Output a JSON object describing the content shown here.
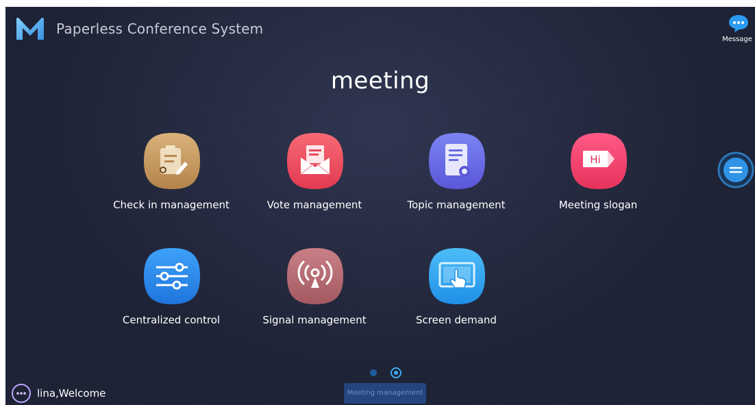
{
  "header": {
    "app_title": "Paperless Conference System",
    "message_label": "Message",
    "logo_icon": "m-logo-icon",
    "message_icon": "chat-bubble-icon"
  },
  "main": {
    "title": "meeting",
    "tiles": [
      {
        "label": "Check in management",
        "icon": "clipboard-pen-icon",
        "color": "#c79a5f"
      },
      {
        "label": "Vote management",
        "icon": "envelope-letter-icon",
        "color": "#ee4f60"
      },
      {
        "label": "Topic management",
        "icon": "document-gear-icon",
        "color": "#6a6ee6"
      },
      {
        "label": "Meeting slogan",
        "icon": "hi-banner-icon",
        "color": "#f0466e"
      },
      {
        "label": "Centralized control",
        "icon": "sliders-icon",
        "color": "#2f8ff0"
      },
      {
        "label": "Signal management",
        "icon": "broadcast-signal-icon",
        "color": "#b86d72"
      },
      {
        "label": "Screen demand",
        "icon": "touch-screen-icon",
        "color": "#36a8f2"
      }
    ]
  },
  "side_handle_icon": "menu-lines-icon",
  "pager": {
    "total_pages": 2,
    "current_page": 2,
    "caption": "Meeting management"
  },
  "footer": {
    "welcome": "lina,Welcome",
    "menu_icon": "more-dots-icon"
  }
}
